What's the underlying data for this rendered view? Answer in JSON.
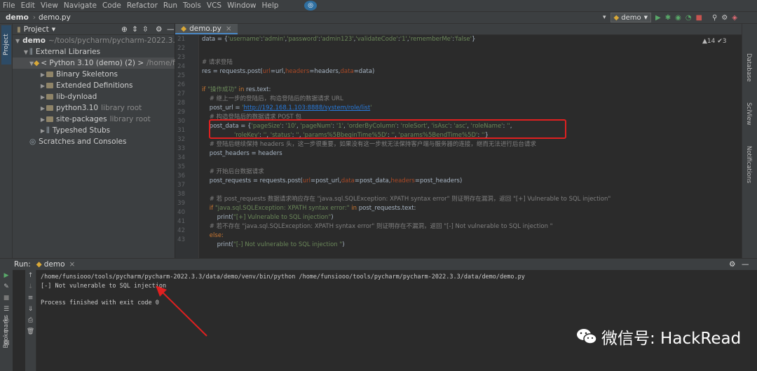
{
  "menu": [
    "File",
    "Edit",
    "View",
    "Navigate",
    "Code",
    "Refactor",
    "Run",
    "Tools",
    "VCS",
    "Window",
    "Help"
  ],
  "nav": {
    "project": "demo",
    "file": "demo.py",
    "run_config": "demo"
  },
  "project_panel": {
    "title": "Project",
    "items": [
      {
        "label": "demo",
        "path": "~/tools/pycharm/pycharm-2022.3.3/data/de",
        "indent": 0
      },
      {
        "label": "External Libraries",
        "indent": 1
      },
      {
        "label": "< Python 3.10 (demo) (2) >",
        "path": "/home/funsiooo/tools",
        "indent": 2,
        "selected": true
      },
      {
        "label": "Binary Skeletons",
        "indent": 3
      },
      {
        "label": "Extended Definitions",
        "indent": 3
      },
      {
        "label": "lib-dynload",
        "indent": 3
      },
      {
        "label": "python3.10",
        "note": "library root",
        "indent": 3
      },
      {
        "label": "site-packages",
        "note": "library root",
        "indent": 3
      },
      {
        "label": "Typeshed Stubs",
        "indent": 3
      },
      {
        "label": "Scratches and Consoles",
        "indent": 1
      }
    ]
  },
  "editor": {
    "tab": "demo.py",
    "inspections": "▲14 ✔3",
    "line_numbers": [
      "21",
      "22",
      "23",
      "24",
      "25",
      "26",
      "27",
      "28",
      "29",
      "30",
      "31",
      "32",
      "33",
      "34",
      "35",
      "36",
      "37",
      "38",
      "39",
      "40",
      "41",
      "42",
      "43"
    ]
  },
  "right_tabs": [
    "Database",
    "SciView",
    "Notifications"
  ],
  "run": {
    "title": "Run:",
    "tab": "demo",
    "lines": [
      "/home/funsiooo/tools/pycharm/pycharm-2022.3.3/data/demo/venv/bin/python /home/funsiooo/tools/pycharm/pycharm-2022.3.3/data/demo/demo.py",
      "[-] Not vulnerable to SQL injection",
      "",
      "Process finished with exit code 0"
    ]
  },
  "watermark": "微信号: HackRead"
}
